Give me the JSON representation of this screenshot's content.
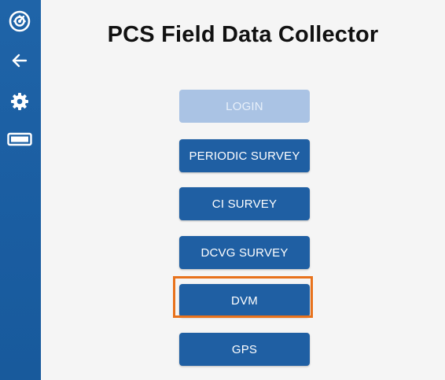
{
  "app": {
    "title": "PCS Field Data Collector"
  },
  "sidebar": {
    "icons": [
      {
        "name": "dashboard-icon"
      },
      {
        "name": "back-arrow-icon"
      },
      {
        "name": "gear-icon"
      },
      {
        "name": "battery-icon"
      }
    ]
  },
  "menu": {
    "login": "LOGIN",
    "periodic_survey": "PERIODIC SURVEY",
    "ci_survey": "CI SURVEY",
    "dcvg_survey": "DCVG SURVEY",
    "dvm": "DVM",
    "gps": "GPS"
  },
  "colors": {
    "sidebar": "#1f64a8",
    "button": "#1f5fa3",
    "button_disabled": "#aac3e4",
    "highlight": "#e8721c"
  }
}
